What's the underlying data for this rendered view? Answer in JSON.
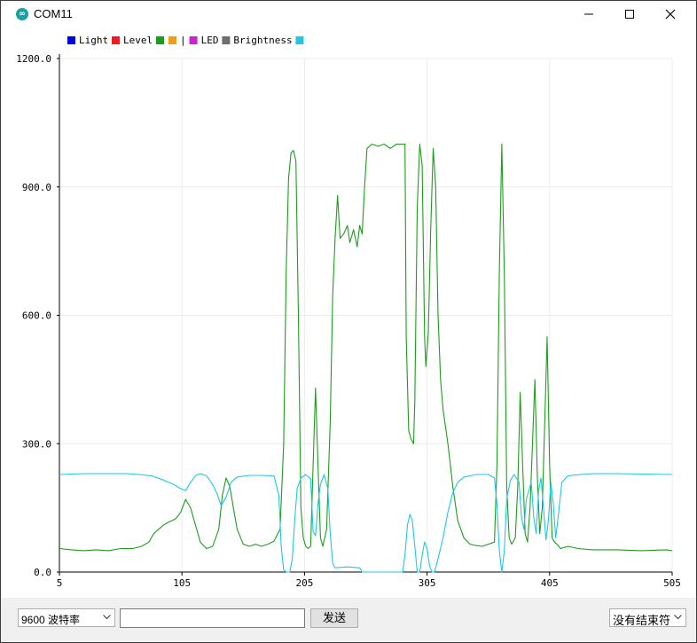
{
  "window": {
    "title": "COM11",
    "app_icon": "arduino-infinity-icon",
    "controls": [
      "minimize-icon",
      "maximize-icon",
      "close-icon"
    ]
  },
  "chart_data": {
    "type": "line",
    "legend": [
      {
        "label": "Light",
        "color": "#0000dd"
      },
      {
        "label": "Level",
        "color": "#ee1c1c"
      },
      {
        "label": "",
        "color": "#1e9c1e"
      },
      {
        "label": "|",
        "color": "#f29b15"
      },
      {
        "label": "LED",
        "color": "#cc22cc"
      },
      {
        "label": "Brightness",
        "color": "#6e6e6e"
      },
      {
        "label": "",
        "color": "#1ec8e6"
      }
    ],
    "xlim": [
      5,
      505
    ],
    "ylim": [
      0,
      1200
    ],
    "x_ticks": [
      "5",
      "105",
      "205",
      "305",
      "405",
      "505"
    ],
    "y_ticks": [
      "0.0",
      "300.0",
      "600.0",
      "900.0",
      "1200.0"
    ],
    "grid": true,
    "series": [
      {
        "color": "#1e9c1e",
        "points": [
          [
            5,
            55
          ],
          [
            15,
            52
          ],
          [
            25,
            50
          ],
          [
            35,
            52
          ],
          [
            45,
            50
          ],
          [
            55,
            55
          ],
          [
            65,
            55
          ],
          [
            72,
            60
          ],
          [
            78,
            70
          ],
          [
            82,
            90
          ],
          [
            86,
            100
          ],
          [
            90,
            110
          ],
          [
            95,
            118
          ],
          [
            100,
            125
          ],
          [
            104,
            140
          ],
          [
            108,
            170
          ],
          [
            112,
            150
          ],
          [
            116,
            110
          ],
          [
            120,
            70
          ],
          [
            125,
            55
          ],
          [
            130,
            60
          ],
          [
            135,
            100
          ],
          [
            138,
            180
          ],
          [
            141,
            220
          ],
          [
            144,
            200
          ],
          [
            147,
            150
          ],
          [
            150,
            100
          ],
          [
            155,
            65
          ],
          [
            160,
            60
          ],
          [
            165,
            65
          ],
          [
            170,
            60
          ],
          [
            175,
            65
          ],
          [
            180,
            72
          ],
          [
            185,
            100
          ],
          [
            188,
            300
          ],
          [
            190,
            700
          ],
          [
            192,
            920
          ],
          [
            194,
            980
          ],
          [
            196,
            985
          ],
          [
            198,
            960
          ],
          [
            200,
            600
          ],
          [
            202,
            150
          ],
          [
            204,
            80
          ],
          [
            206,
            60
          ],
          [
            208,
            55
          ],
          [
            210,
            60
          ],
          [
            212,
            250
          ],
          [
            214,
            430
          ],
          [
            216,
            250
          ],
          [
            218,
            80
          ],
          [
            220,
            60
          ],
          [
            223,
            100
          ],
          [
            226,
            350
          ],
          [
            228,
            650
          ],
          [
            230,
            780
          ],
          [
            232,
            880
          ],
          [
            234,
            780
          ],
          [
            237,
            790
          ],
          [
            240,
            810
          ],
          [
            242,
            770
          ],
          [
            245,
            800
          ],
          [
            248,
            760
          ],
          [
            250,
            810
          ],
          [
            252,
            790
          ],
          [
            254,
            900
          ],
          [
            256,
            990
          ],
          [
            260,
            1000
          ],
          [
            265,
            995
          ],
          [
            270,
            1000
          ],
          [
            275,
            990
          ],
          [
            280,
            1000
          ],
          [
            287,
            1000
          ],
          [
            288,
            550
          ],
          [
            290,
            330
          ],
          [
            292,
            310
          ],
          [
            294,
            300
          ],
          [
            295,
            400
          ],
          [
            297,
            850
          ],
          [
            299,
            1000
          ],
          [
            301,
            950
          ],
          [
            303,
            550
          ],
          [
            304,
            480
          ],
          [
            306,
            560
          ],
          [
            308,
            800
          ],
          [
            310,
            990
          ],
          [
            312,
            900
          ],
          [
            314,
            600
          ],
          [
            316,
            450
          ],
          [
            318,
            380
          ],
          [
            322,
            300
          ],
          [
            326,
            200
          ],
          [
            330,
            120
          ],
          [
            335,
            80
          ],
          [
            340,
            65
          ],
          [
            345,
            62
          ],
          [
            350,
            60
          ],
          [
            355,
            65
          ],
          [
            360,
            70
          ],
          [
            362,
            250
          ],
          [
            364,
            700
          ],
          [
            366,
            1000
          ],
          [
            368,
            700
          ],
          [
            370,
            200
          ],
          [
            372,
            80
          ],
          [
            374,
            65
          ],
          [
            377,
            80
          ],
          [
            379,
            200
          ],
          [
            381,
            420
          ],
          [
            383,
            250
          ],
          [
            385,
            90
          ],
          [
            387,
            70
          ],
          [
            389,
            150
          ],
          [
            391,
            300
          ],
          [
            393,
            450
          ],
          [
            395,
            220
          ],
          [
            397,
            90
          ],
          [
            399,
            150
          ],
          [
            401,
            350
          ],
          [
            403,
            550
          ],
          [
            405,
            250
          ],
          [
            407,
            80
          ],
          [
            409,
            70
          ],
          [
            411,
            65
          ],
          [
            414,
            55
          ],
          [
            420,
            60
          ],
          [
            428,
            55
          ],
          [
            440,
            52
          ],
          [
            460,
            52
          ],
          [
            480,
            50
          ],
          [
            500,
            52
          ],
          [
            505,
            50
          ]
        ]
      },
      {
        "color": "#1ec8e6",
        "points": [
          [
            5,
            228
          ],
          [
            25,
            230
          ],
          [
            45,
            230
          ],
          [
            60,
            230
          ],
          [
            70,
            228
          ],
          [
            80,
            225
          ],
          [
            90,
            215
          ],
          [
            98,
            205
          ],
          [
            104,
            195
          ],
          [
            108,
            190
          ],
          [
            112,
            210
          ],
          [
            116,
            225
          ],
          [
            120,
            230
          ],
          [
            125,
            225
          ],
          [
            130,
            205
          ],
          [
            134,
            180
          ],
          [
            137,
            155
          ],
          [
            141,
            175
          ],
          [
            145,
            210
          ],
          [
            150,
            222
          ],
          [
            160,
            226
          ],
          [
            170,
            226
          ],
          [
            180,
            225
          ],
          [
            184,
            180
          ],
          [
            186,
            60
          ],
          [
            188,
            5
          ],
          [
            190,
            0
          ],
          [
            193,
            0
          ],
          [
            195,
            30
          ],
          [
            197,
            120
          ],
          [
            199,
            195
          ],
          [
            202,
            220
          ],
          [
            206,
            228
          ],
          [
            210,
            218
          ],
          [
            212,
            95
          ],
          [
            214,
            85
          ],
          [
            216,
            160
          ],
          [
            218,
            205
          ],
          [
            221,
            228
          ],
          [
            224,
            195
          ],
          [
            226,
            90
          ],
          [
            228,
            20
          ],
          [
            230,
            10
          ],
          [
            240,
            12
          ],
          [
            250,
            10
          ],
          [
            252,
            0
          ],
          [
            260,
            0
          ],
          [
            270,
            0
          ],
          [
            285,
            0
          ],
          [
            287,
            40
          ],
          [
            289,
            110
          ],
          [
            291,
            135
          ],
          [
            293,
            120
          ],
          [
            295,
            60
          ],
          [
            297,
            0
          ],
          [
            299,
            0
          ],
          [
            301,
            40
          ],
          [
            303,
            70
          ],
          [
            305,
            55
          ],
          [
            307,
            15
          ],
          [
            309,
            0
          ],
          [
            311,
            0
          ],
          [
            313,
            20
          ],
          [
            318,
            80
          ],
          [
            322,
            140
          ],
          [
            326,
            185
          ],
          [
            330,
            210
          ],
          [
            335,
            222
          ],
          [
            345,
            228
          ],
          [
            355,
            228
          ],
          [
            360,
            220
          ],
          [
            362,
            160
          ],
          [
            364,
            50
          ],
          [
            366,
            0
          ],
          [
            368,
            50
          ],
          [
            370,
            170
          ],
          [
            373,
            215
          ],
          [
            376,
            228
          ],
          [
            380,
            210
          ],
          [
            382,
            130
          ],
          [
            384,
            100
          ],
          [
            386,
            170
          ],
          [
            390,
            210
          ],
          [
            392,
            130
          ],
          [
            394,
            90
          ],
          [
            396,
            190
          ],
          [
            398,
            220
          ],
          [
            400,
            150
          ],
          [
            402,
            75
          ],
          [
            404,
            120
          ],
          [
            406,
            210
          ],
          [
            408,
            160
          ],
          [
            410,
            80
          ],
          [
            412,
            130
          ],
          [
            415,
            210
          ],
          [
            420,
            225
          ],
          [
            430,
            228
          ],
          [
            440,
            230
          ],
          [
            460,
            230
          ],
          [
            480,
            229
          ],
          [
            505,
            228
          ]
        ]
      }
    ]
  },
  "controls": {
    "baud_rate": "9600 波特率",
    "send_input_value": "",
    "send_label": "发送",
    "line_ending": "没有结束符"
  }
}
